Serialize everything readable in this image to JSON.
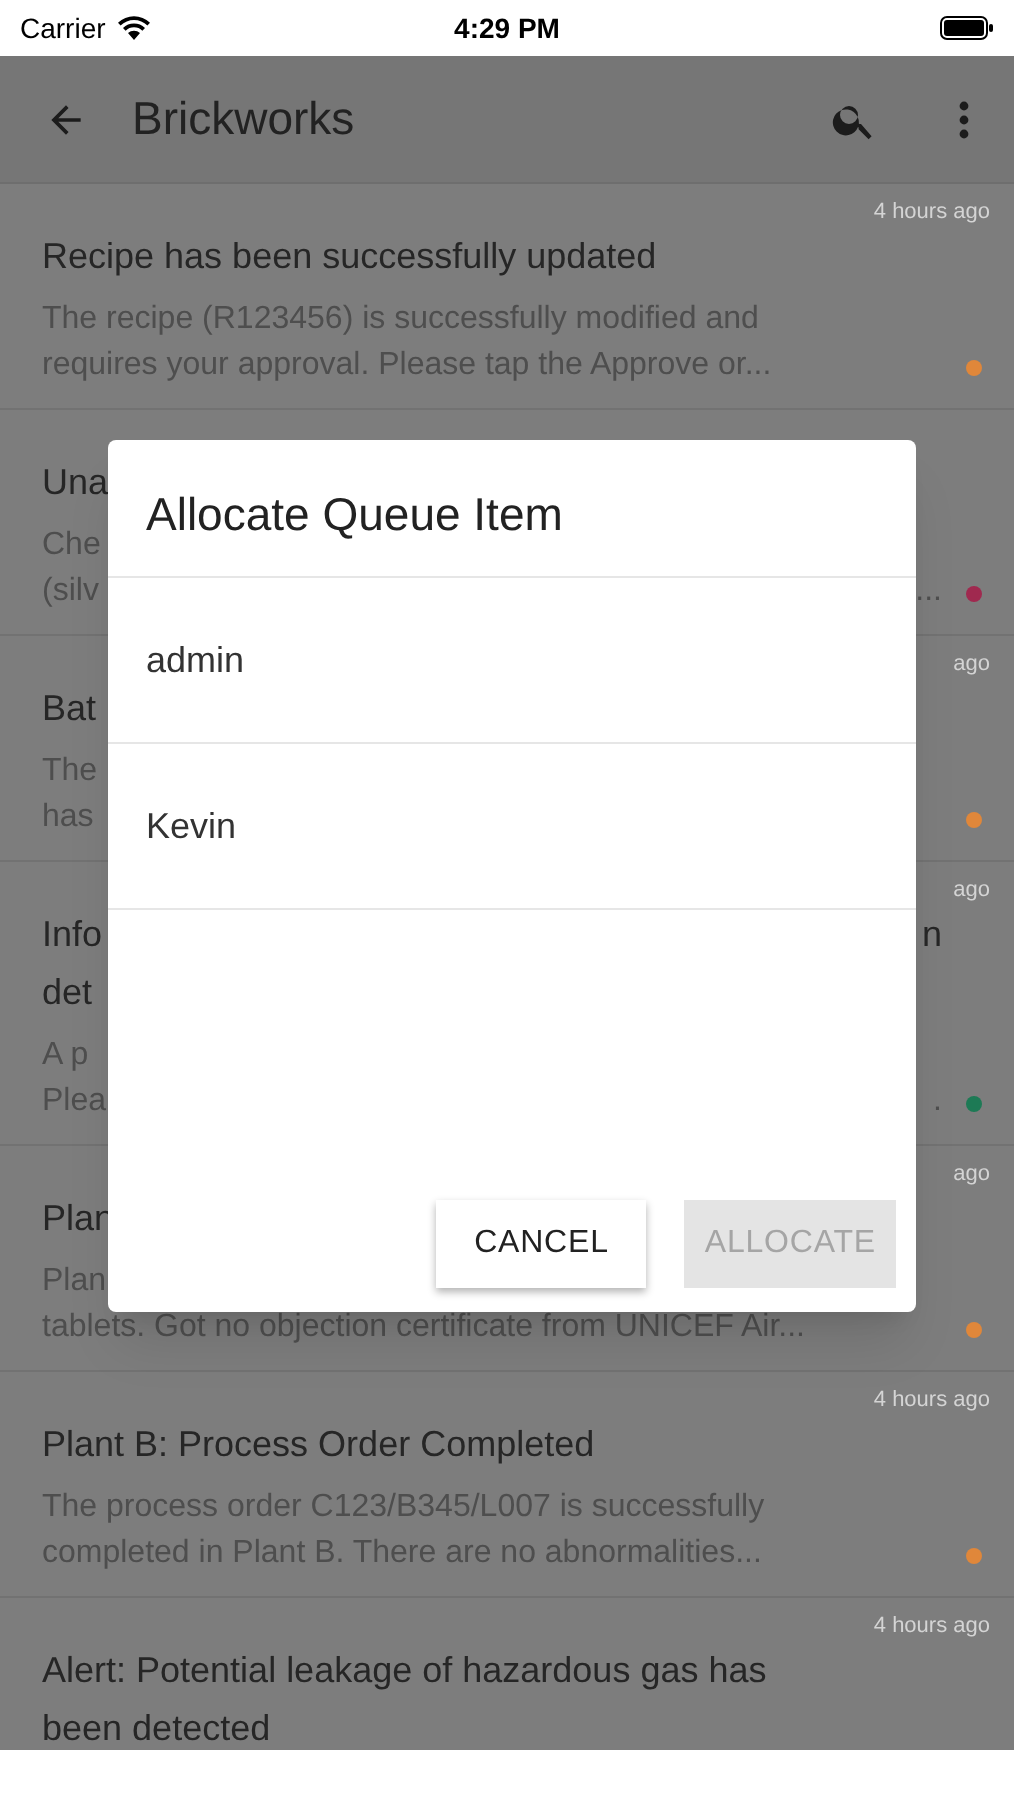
{
  "status_bar": {
    "carrier": "Carrier",
    "time": "4:29 PM"
  },
  "app_bar": {
    "title": "Brickworks"
  },
  "notifications": [
    {
      "time": "4 hours ago",
      "title": [
        {
          "left": "Recipe has been successfully updated"
        }
      ],
      "body": [
        {
          "left": "The recipe (R123456) is successfully modified and"
        },
        {
          "left": "requires your approval. Please tap the Approve or..."
        }
      ],
      "color": "#e0873a"
    },
    {
      "title": [
        {
          "left": "Una"
        }
      ],
      "body": [
        {
          "left": "Che"
        },
        {
          "left": "(silv",
          "right": "..."
        }
      ],
      "color": "#a0294f"
    },
    {
      "time": "ago",
      "title": [
        {
          "left": "Bat"
        }
      ],
      "body": [
        {
          "left": "The"
        },
        {
          "left": "has"
        }
      ],
      "color": "#e0873a"
    },
    {
      "time": "ago",
      "title": [
        {
          "left": "Info",
          "right": "n"
        },
        {
          "left": "det"
        }
      ],
      "body": [
        {
          "left": "A p"
        },
        {
          "left": "Plea",
          "right": "."
        }
      ],
      "color": "#1d7a55"
    },
    {
      "time": "ago",
      "title": [
        {
          "left": "Plan"
        }
      ],
      "body": [
        {
          "left": "Plan"
        },
        {
          "left": "tablets. Got no objection certificate from UNICEF Air..."
        }
      ],
      "color": "#e0873a"
    },
    {
      "time": "4 hours ago",
      "title": [
        {
          "left": "Plant B: Process Order Completed"
        }
      ],
      "body": [
        {
          "left": "The process order C123/B345/L007 is successfully"
        },
        {
          "left": "completed in Plant B. There are no abnormalities..."
        }
      ],
      "color": "#e0873a"
    },
    {
      "time": "4 hours ago",
      "title": [
        {
          "left": "Alert: Potential leakage of hazardous gas has"
        },
        {
          "left": "been detected"
        }
      ]
    }
  ],
  "dialog": {
    "title": "Allocate Queue Item",
    "options": [
      "admin",
      "Kevin"
    ],
    "buttons": [
      {
        "label": "CANCEL",
        "disabled": false
      },
      {
        "label": "ALLOCATE",
        "disabled": true
      }
    ]
  }
}
